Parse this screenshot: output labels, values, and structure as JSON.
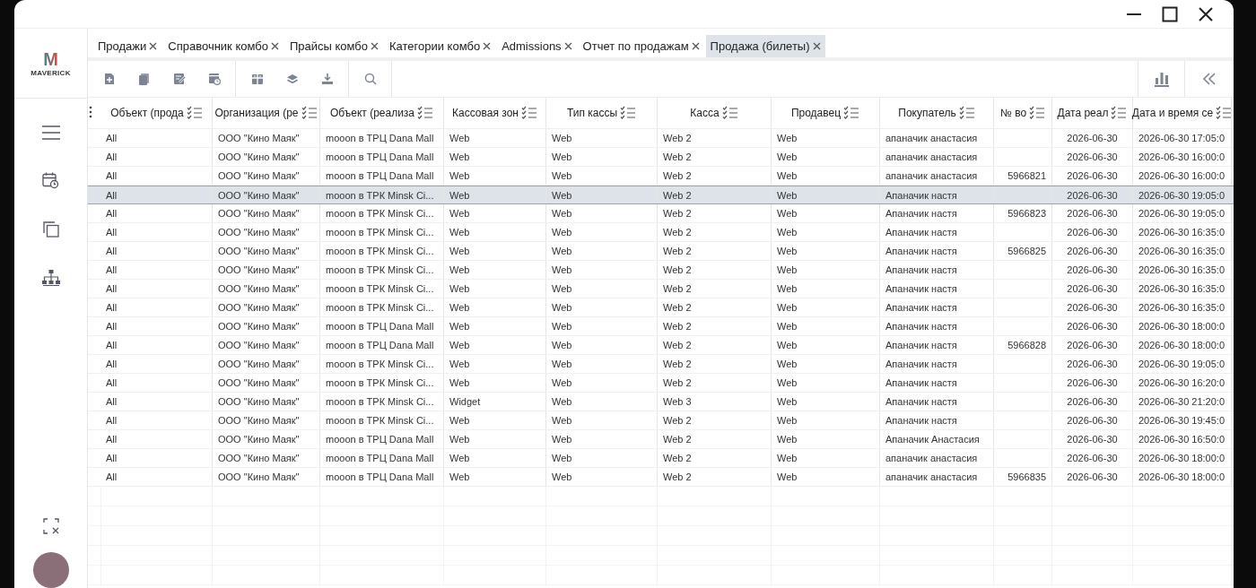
{
  "brand": {
    "logo_letter": "M",
    "name": "MAVERICK"
  },
  "tabs": [
    {
      "label": "Продажи",
      "selected": false
    },
    {
      "label": "Справочник комбо",
      "selected": false
    },
    {
      "label": "Прайсы комбо",
      "selected": false
    },
    {
      "label": "Категории комбо",
      "selected": false
    },
    {
      "label": "Admissions",
      "selected": false
    },
    {
      "label": "Отчет по продажам",
      "selected": false
    },
    {
      "label": "Продажа (билеты)",
      "selected": true
    }
  ],
  "table": {
    "columns": [
      "Объект (прода",
      "Организация (ре",
      "Объект (реализа",
      "Кассовая зон",
      "Тип кассы",
      "Касса",
      "Продавец",
      "Покупатель",
      "№ во",
      "Дата реал",
      "Дата и время се"
    ],
    "rows": [
      {
        "selected": false,
        "cells": [
          "All",
          "ООО \"Кино Маяк\"",
          "mooon в ТРЦ Dana Mall",
          "Web",
          "Web",
          "Web 2",
          "Web",
          "апаначик анастасия",
          "",
          "2026-06-30",
          "2026-06-30 17:05:0"
        ]
      },
      {
        "selected": false,
        "cells": [
          "All",
          "ООО \"Кино Маяк\"",
          "mooon в ТРЦ Dana Mall",
          "Web",
          "Web",
          "Web 2",
          "Web",
          "апаначик анастасия",
          "",
          "2026-06-30",
          "2026-06-30 16:00:0"
        ]
      },
      {
        "selected": false,
        "cells": [
          "All",
          "ООО \"Кино Маяк\"",
          "mooon в ТРЦ Dana Mall",
          "Web",
          "Web",
          "Web 2",
          "Web",
          "апаначик анастасия",
          "5966821",
          "2026-06-30",
          "2026-06-30 16:00:0"
        ]
      },
      {
        "selected": true,
        "cells": [
          "All",
          "ООО \"Кино Маяк\"",
          "mooon в ТРК Minsk Ci...",
          "Web",
          "Web",
          "Web 2",
          "Web",
          "Апаначик настя",
          "",
          "2026-06-30",
          "2026-06-30 19:05:0"
        ]
      },
      {
        "selected": false,
        "cells": [
          "All",
          "ООО \"Кино Маяк\"",
          "mooon в ТРК Minsk Ci...",
          "Web",
          "Web",
          "Web 2",
          "Web",
          "Апаначик настя",
          "5966823",
          "2026-06-30",
          "2026-06-30 19:05:0"
        ]
      },
      {
        "selected": false,
        "cells": [
          "All",
          "ООО \"Кино Маяк\"",
          "mooon в ТРК Minsk Ci...",
          "Web",
          "Web",
          "Web 2",
          "Web",
          "Апаначик настя",
          "",
          "2026-06-30",
          "2026-06-30 16:35:0"
        ]
      },
      {
        "selected": false,
        "cells": [
          "All",
          "ООО \"Кино Маяк\"",
          "mooon в ТРК Minsk Ci...",
          "Web",
          "Web",
          "Web 2",
          "Web",
          "Апаначик настя",
          "5966825",
          "2026-06-30",
          "2026-06-30 16:35:0"
        ]
      },
      {
        "selected": false,
        "cells": [
          "All",
          "ООО \"Кино Маяк\"",
          "mooon в ТРК Minsk Ci...",
          "Web",
          "Web",
          "Web 2",
          "Web",
          "Апаначик настя",
          "",
          "2026-06-30",
          "2026-06-30 16:35:0"
        ]
      },
      {
        "selected": false,
        "cells": [
          "All",
          "ООО \"Кино Маяк\"",
          "mooon в ТРК Minsk Ci...",
          "Web",
          "Web",
          "Web 2",
          "Web",
          "Апаначик настя",
          "",
          "2026-06-30",
          "2026-06-30 16:35:0"
        ]
      },
      {
        "selected": false,
        "cells": [
          "All",
          "ООО \"Кино Маяк\"",
          "mooon в ТРК Minsk Ci...",
          "Web",
          "Web",
          "Web 2",
          "Web",
          "Апаначик настя",
          "",
          "2026-06-30",
          "2026-06-30 16:35:0"
        ]
      },
      {
        "selected": false,
        "cells": [
          "All",
          "ООО \"Кино Маяк\"",
          "mooon в ТРЦ Dana Mall",
          "Web",
          "Web",
          "Web 2",
          "Web",
          "Апаначик настя",
          "",
          "2026-06-30",
          "2026-06-30 18:00:0"
        ]
      },
      {
        "selected": false,
        "cells": [
          "All",
          "ООО \"Кино Маяк\"",
          "mooon в ТРЦ Dana Mall",
          "Web",
          "Web",
          "Web 2",
          "Web",
          "Апаначик настя",
          "5966828",
          "2026-06-30",
          "2026-06-30 18:00:0"
        ]
      },
      {
        "selected": false,
        "cells": [
          "All",
          "ООО \"Кино Маяк\"",
          "mooon в ТРК Minsk Ci...",
          "Web",
          "Web",
          "Web 2",
          "Web",
          "Апаначик настя",
          "",
          "2026-06-30",
          "2026-06-30 19:05:0"
        ]
      },
      {
        "selected": false,
        "cells": [
          "All",
          "ООО \"Кино Маяк\"",
          "mooon в ТРК Minsk Ci...",
          "Web",
          "Web",
          "Web 2",
          "Web",
          "Апаначик настя",
          "",
          "2026-06-30",
          "2026-06-30 16:20:0"
        ]
      },
      {
        "selected": false,
        "cells": [
          "All",
          "ООО \"Кино Маяк\"",
          "mooon в ТРК Minsk Ci...",
          "Widget",
          "Web",
          "Web 3",
          "Web",
          "Апаначик настя",
          "",
          "2026-06-30",
          "2026-06-30 21:20:0"
        ]
      },
      {
        "selected": false,
        "cells": [
          "All",
          "ООО \"Кино Маяк\"",
          "mooon в ТРК Minsk Ci...",
          "Web",
          "Web",
          "Web 2",
          "Web",
          "Апаначик настя",
          "",
          "2026-06-30",
          "2026-06-30 19:45:0"
        ]
      },
      {
        "selected": false,
        "cells": [
          "All",
          "ООО \"Кино Маяк\"",
          "mooon в ТРЦ Dana Mall",
          "Web",
          "Web",
          "Web 2",
          "Web",
          "Апаначик Анастасия",
          "",
          "2026-06-30",
          "2026-06-30 16:50:0"
        ]
      },
      {
        "selected": false,
        "cells": [
          "All",
          "ООО \"Кино Маяк\"",
          "mooon в ТРЦ Dana Mall",
          "Web",
          "Web",
          "Web 2",
          "Web",
          "апаначик анастасия",
          "",
          "2026-06-30",
          "2026-06-30 18:00:0"
        ]
      },
      {
        "selected": false,
        "cells": [
          "All",
          "ООО \"Кино Маяк\"",
          "mooon в ТРЦ Dana Mall",
          "Web",
          "Web",
          "Web 2",
          "Web",
          "апаначик анастасия",
          "5966835",
          "2026-06-30",
          "2026-06-30 18:00:0"
        ]
      }
    ]
  }
}
